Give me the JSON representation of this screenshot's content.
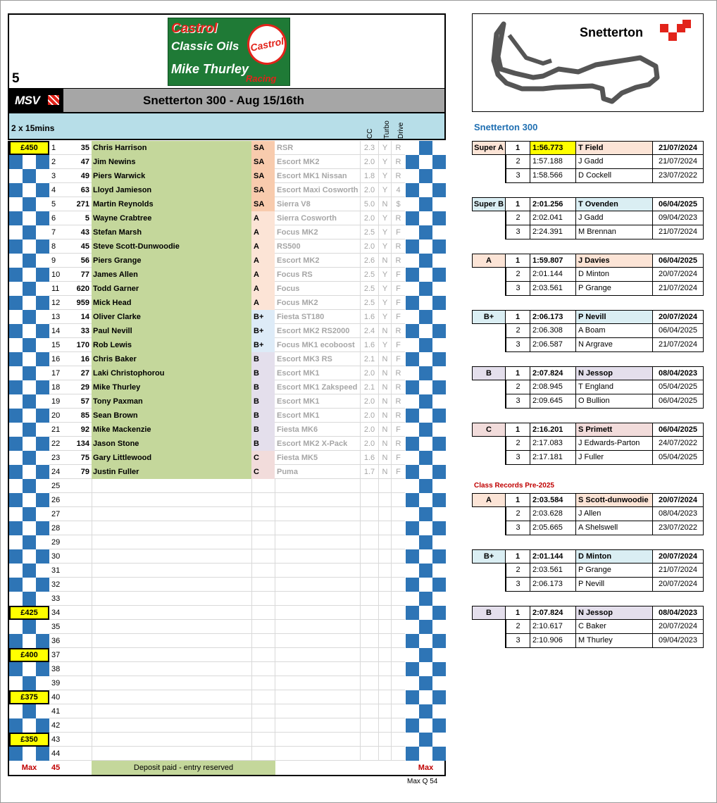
{
  "header": {
    "race_number": "5",
    "logo": {
      "l1": "Castrol",
      "l2": "Classic Oils",
      "l3": "Mike Thurley",
      "l4": "Racing",
      "badge": "Castrol"
    },
    "msv": "MSV",
    "event_title": "Snetterton 300 - Aug 15/16th",
    "format": "2 x 15mins",
    "col_cc": "CC",
    "col_turbo": "Turbo",
    "col_drive": "Drive"
  },
  "entries": [
    {
      "pos": "1",
      "num": "35",
      "name": "Chris Harrison",
      "cls": "SA",
      "car": "RSR",
      "cc": "2.3",
      "turbo": "Y",
      "drive": "R"
    },
    {
      "pos": "2",
      "num": "47",
      "name": "Jim Newins",
      "cls": "SA",
      "car": "Escort MK2",
      "cc": "2.0",
      "turbo": "Y",
      "drive": "R"
    },
    {
      "pos": "3",
      "num": "49",
      "name": "Piers Warwick",
      "cls": "SA",
      "car": "Escort MK1 Nissan",
      "cc": "1.8",
      "turbo": "Y",
      "drive": "R"
    },
    {
      "pos": "4",
      "num": "63",
      "name": "Lloyd Jamieson",
      "cls": "SA",
      "car": "Escort Maxi Cosworth",
      "cc": "2.0",
      "turbo": "Y",
      "drive": "4"
    },
    {
      "pos": "5",
      "num": "271",
      "name": "Martin Reynolds",
      "cls": "SA",
      "car": "Sierra V8",
      "cc": "5.0",
      "turbo": "N",
      "drive": "$"
    },
    {
      "pos": "6",
      "num": "5",
      "name": "Wayne Crabtree",
      "cls": "A",
      "car": "Sierra Cosworth",
      "cc": "2.0",
      "turbo": "Y",
      "drive": "R"
    },
    {
      "pos": "7",
      "num": "43",
      "name": "Stefan Marsh",
      "cls": "A",
      "car": "Focus MK2",
      "cc": "2.5",
      "turbo": "Y",
      "drive": "F"
    },
    {
      "pos": "8",
      "num": "45",
      "name": "Steve Scott-Dunwoodie",
      "cls": "A",
      "car": "RS500",
      "cc": "2.0",
      "turbo": "Y",
      "drive": "R"
    },
    {
      "pos": "9",
      "num": "56",
      "name": "Piers Grange",
      "cls": "A",
      "car": "Escort MK2",
      "cc": "2.6",
      "turbo": "N",
      "drive": "R"
    },
    {
      "pos": "10",
      "num": "77",
      "name": "James Allen",
      "cls": "A",
      "car": "Focus RS",
      "cc": "2.5",
      "turbo": "Y",
      "drive": "F"
    },
    {
      "pos": "11",
      "num": "620",
      "name": "Todd Garner",
      "cls": "A",
      "car": "Focus",
      "cc": "2.5",
      "turbo": "Y",
      "drive": "F"
    },
    {
      "pos": "12",
      "num": "959",
      "name": "Mick Head",
      "cls": "A",
      "car": "Focus MK2",
      "cc": "2.5",
      "turbo": "Y",
      "drive": "F"
    },
    {
      "pos": "13",
      "num": "14",
      "name": "Oliver Clarke",
      "cls": "B+",
      "car": "Fiesta ST180",
      "cc": "1.6",
      "turbo": "Y",
      "drive": "F"
    },
    {
      "pos": "14",
      "num": "33",
      "name": "Paul Nevill",
      "cls": "B+",
      "car": "Escort MK2 RS2000",
      "cc": "2.4",
      "turbo": "N",
      "drive": "R"
    },
    {
      "pos": "15",
      "num": "170",
      "name": "Rob Lewis",
      "cls": "B+",
      "car": "Focus MK1 ecoboost",
      "cc": "1.6",
      "turbo": "Y",
      "drive": "F"
    },
    {
      "pos": "16",
      "num": "16",
      "name": "Chris Baker",
      "cls": "B",
      "car": "Escort MK3 RS",
      "cc": "2.1",
      "turbo": "N",
      "drive": "F"
    },
    {
      "pos": "17",
      "num": "27",
      "name": "Laki Christophorou",
      "cls": "B",
      "car": "Escort MK1",
      "cc": "2.0",
      "turbo": "N",
      "drive": "R"
    },
    {
      "pos": "18",
      "num": "29",
      "name": "Mike Thurley",
      "cls": "B",
      "car": "Escort MK1 Zakspeed",
      "cc": "2.1",
      "turbo": "N",
      "drive": "R"
    },
    {
      "pos": "19",
      "num": "57",
      "name": "Tony Paxman",
      "cls": "B",
      "car": "Escort MK1",
      "cc": "2.0",
      "turbo": "N",
      "drive": "R"
    },
    {
      "pos": "20",
      "num": "85",
      "name": "Sean Brown",
      "cls": "B",
      "car": "Escort MK1",
      "cc": "2.0",
      "turbo": "N",
      "drive": "R"
    },
    {
      "pos": "21",
      "num": "92",
      "name": "Mike Mackenzie",
      "cls": "B",
      "car": "Fiesta MK6",
      "cc": "2.0",
      "turbo": "N",
      "drive": "F"
    },
    {
      "pos": "22",
      "num": "134",
      "name": "Jason Stone",
      "cls": "B",
      "car": "Escort MK2 X-Pack",
      "cc": "2.0",
      "turbo": "N",
      "drive": "R"
    },
    {
      "pos": "23",
      "num": "75",
      "name": "Gary Littlewood",
      "cls": "C",
      "car": "Fiesta MK5",
      "cc": "1.6",
      "turbo": "N",
      "drive": "F"
    },
    {
      "pos": "24",
      "num": "79",
      "name": "Justin Fuller",
      "cls": "C",
      "car": "Puma",
      "cc": "1.7",
      "turbo": "N",
      "drive": "F"
    }
  ],
  "empty_positions": [
    "25",
    "26",
    "27",
    "28",
    "29",
    "30",
    "31",
    "32",
    "33",
    "34",
    "35",
    "36",
    "37",
    "38",
    "39",
    "40",
    "41",
    "42",
    "43",
    "44"
  ],
  "price_tags": [
    {
      "pos": "1",
      "label": "£450"
    },
    {
      "pos": "34",
      "label": "£425"
    },
    {
      "pos": "37",
      "label": "£400"
    },
    {
      "pos": "40",
      "label": "£375"
    },
    {
      "pos": "43",
      "label": "£350"
    }
  ],
  "footer": {
    "max_left": "Max",
    "max_num": "45",
    "deposit": "Deposit paid - entry reserved",
    "max_right": "Max",
    "max_q": "Max Q 54"
  },
  "track": {
    "name": "Snetterton"
  },
  "records_title": "Snetterton 300",
  "records": [
    {
      "cls": "Super A",
      "color": "#fce4d6",
      "rows": [
        [
          "1",
          "1:56.773",
          "T Field",
          "21/07/2024"
        ],
        [
          "2",
          "1:57.188",
          "J Gadd",
          "21/07/2024"
        ],
        [
          "3",
          "1:58.566",
          "D Cockell",
          "23/07/2022"
        ]
      ]
    },
    {
      "cls": "Super B",
      "color": "#daeef3",
      "rows": [
        [
          "1",
          "2:01.256",
          "T Ovenden",
          "06/04/2025"
        ],
        [
          "2",
          "2:02.041",
          "J Gadd",
          "09/04/2023"
        ],
        [
          "3",
          "2:24.391",
          "M Brennan",
          "21/07/2024"
        ]
      ]
    },
    {
      "cls": "A",
      "color": "#fce4d6",
      "rows": [
        [
          "1",
          "1:59.807",
          "J Davies",
          "06/04/2025"
        ],
        [
          "2",
          "2:01.144",
          "D Minton",
          "20/07/2024"
        ],
        [
          "3",
          "2:03.561",
          "P Grange",
          "21/07/2024"
        ]
      ]
    },
    {
      "cls": "B+",
      "color": "#daeef3",
      "rows": [
        [
          "1",
          "2:06.173",
          "P Nevill",
          "20/07/2024"
        ],
        [
          "2",
          "2:06.308",
          "A Boam",
          "06/04/2025"
        ],
        [
          "3",
          "2:06.587",
          "N Argrave",
          "21/07/2024"
        ]
      ]
    },
    {
      "cls": "B",
      "color": "#e4dfec",
      "rows": [
        [
          "1",
          "2:07.824",
          "N Jessop",
          "08/04/2023"
        ],
        [
          "2",
          "2:08.945",
          "T England",
          "05/04/2025"
        ],
        [
          "3",
          "2:09.645",
          "O Bullion",
          "06/04/2025"
        ]
      ]
    },
    {
      "cls": "C",
      "color": "#f2dcdb",
      "rows": [
        [
          "1",
          "2:16.201",
          "S Primett",
          "06/04/2025"
        ],
        [
          "2",
          "2:17.083",
          "J Edwards-Parton",
          "24/07/2022"
        ],
        [
          "3",
          "2:17.181",
          "J Fuller",
          "05/04/2025"
        ]
      ]
    }
  ],
  "pre2025_title": "Class Records Pre-2025",
  "pre2025": [
    {
      "cls": "A",
      "color": "#fce4d6",
      "rows": [
        [
          "1",
          "2:03.584",
          "S Scott-dunwoodie",
          "20/07/2024"
        ],
        [
          "2",
          "2:03.628",
          "J Allen",
          "08/04/2023"
        ],
        [
          "3",
          "2:05.665",
          "A Shelswell",
          "23/07/2022"
        ]
      ]
    },
    {
      "cls": "B+",
      "color": "#daeef3",
      "rows": [
        [
          "1",
          "2:01.144",
          "D Minton",
          "20/07/2024"
        ],
        [
          "2",
          "2:03.561",
          "P Grange",
          "21/07/2024"
        ],
        [
          "3",
          "2:06.173",
          "P Nevill",
          "20/07/2024"
        ]
      ]
    },
    {
      "cls": "B",
      "color": "#e4dfec",
      "rows": [
        [
          "1",
          "2:07.824",
          "N Jessop",
          "08/04/2023"
        ],
        [
          "2",
          "2:10.617",
          "C Baker",
          "20/07/2024"
        ],
        [
          "3",
          "2:10.906",
          "M Thurley",
          "09/04/2023"
        ]
      ]
    }
  ]
}
